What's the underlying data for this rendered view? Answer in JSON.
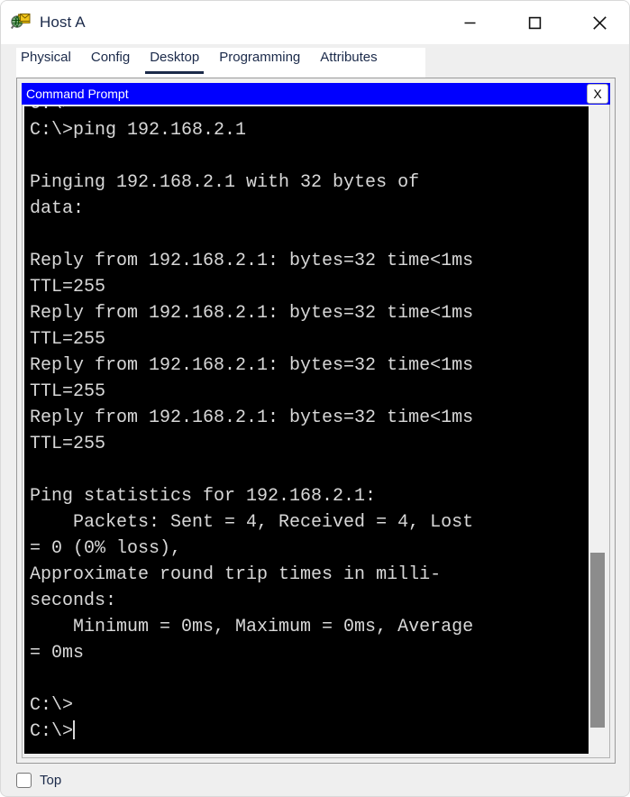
{
  "window": {
    "title": "Host A",
    "icon": "packet-tracer-host-icon",
    "controls": {
      "minimize_label": "—",
      "maximize_label": "▢",
      "close_label": "✕"
    }
  },
  "tabs": [
    {
      "label": "Physical",
      "active": false
    },
    {
      "label": "Config",
      "active": false
    },
    {
      "label": "Desktop",
      "active": true
    },
    {
      "label": "Programming",
      "active": false
    },
    {
      "label": "Attributes",
      "active": false
    }
  ],
  "command_prompt": {
    "title": "Command Prompt",
    "close_label": "X",
    "background_color": "#000000",
    "titlebar_color": "#0000FF",
    "text_color": "#D8D8D8",
    "lines": [
      "C:\\>ping 192.168.2.1",
      "",
      "Pinging 192.168.2.1 with 32 bytes of",
      "data:",
      "",
      "Reply from 192.168.2.1: bytes=32 time<1ms",
      "TTL=255",
      "Reply from 192.168.2.1: bytes=32 time<1ms",
      "TTL=255",
      "Reply from 192.168.2.1: bytes=32 time<1ms",
      "TTL=255",
      "Reply from 192.168.2.1: bytes=32 time<1ms",
      "TTL=255",
      "",
      "Ping statistics for 192.168.2.1:",
      "    Packets: Sent = 4, Received = 4, Lost",
      "= 0 (0% loss),",
      "Approximate round trip times in milli-",
      "seconds:",
      "    Minimum = 0ms, Maximum = 0ms, Average",
      "= 0ms",
      "",
      "C:\\>",
      "C:\\>"
    ],
    "partial_top_line": "C:\\>",
    "scrollbar": {
      "thumb_top_pct": 69,
      "thumb_height_pct": 27
    }
  },
  "footer": {
    "top_checkbox_label": "Top",
    "top_checkbox_checked": false
  }
}
